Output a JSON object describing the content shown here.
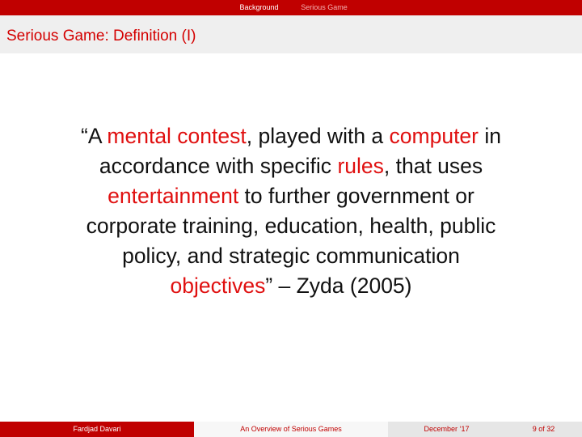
{
  "nav": {
    "sections": [
      "Background",
      "Serious Game"
    ]
  },
  "frame": {
    "title": "Serious Game: Definition (I)"
  },
  "quote": {
    "l1a": "“A ",
    "l1b": "mental contest",
    "l1c": ", played with a ",
    "l1d": "computer",
    "l1e": " in",
    "l2a": "accordance with specific ",
    "l2b": "rules",
    "l2c": ", that uses",
    "l3a": "entertainment",
    "l3b": " to further government or",
    "l4": "corporate training, education, health, public",
    "l5": "policy, and strategic communication",
    "l6a": "objectives",
    "l6b": "” – Zyda (2005)"
  },
  "footer": {
    "author": "Fardjad Davari",
    "talk_title": "An Overview of Serious Games",
    "date": "December ‘17",
    "page": "9 of 32"
  },
  "colors": {
    "accent": "#c00000",
    "highlight": "#e01010",
    "title_bar": "#efefef"
  }
}
